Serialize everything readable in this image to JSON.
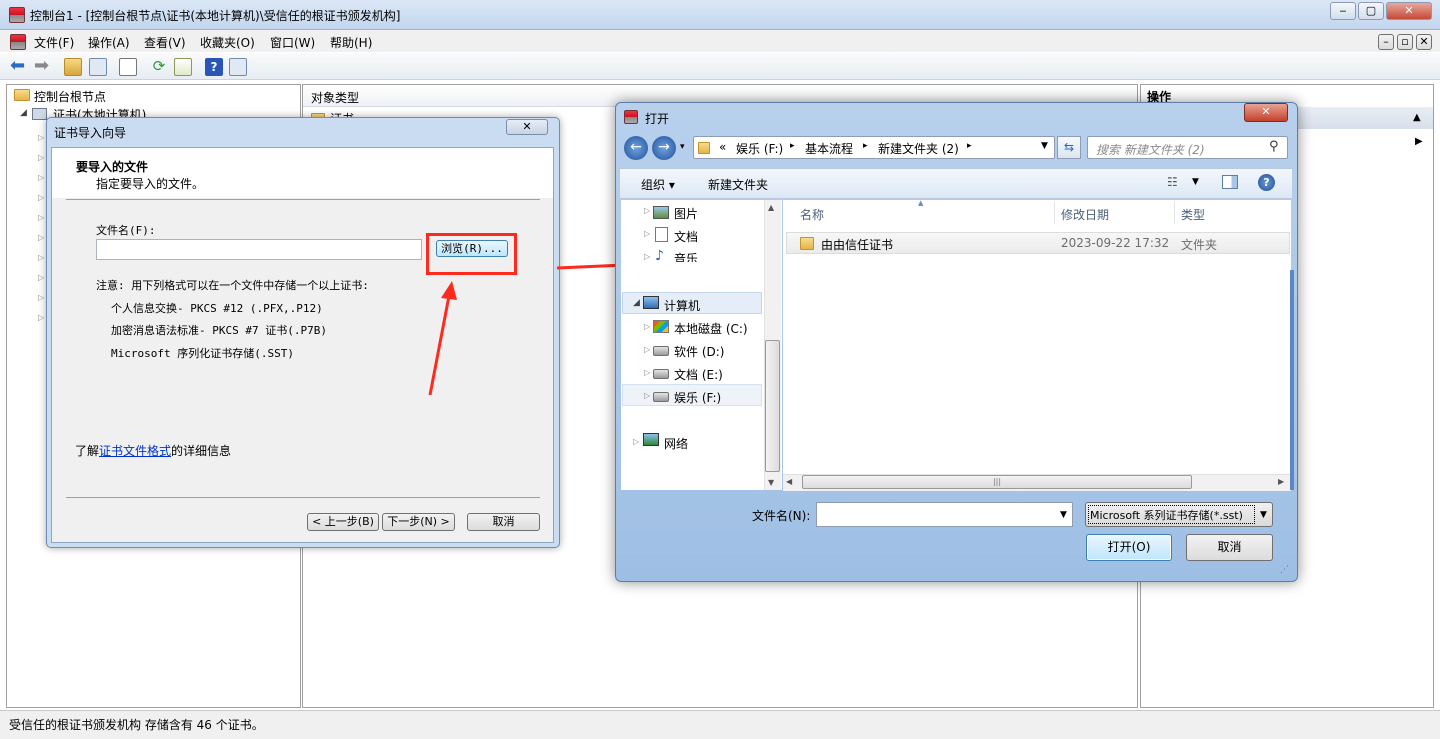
{
  "window": {
    "title": "控制台1 - [控制台根节点\\证书(本地计算机)\\受信任的根证书颁发机构]",
    "min": "‒",
    "max": "▢",
    "close": "✕"
  },
  "menubar": {
    "items": [
      "文件(F)",
      "操作(A)",
      "查看(V)",
      "收藏夹(O)",
      "窗口(W)",
      "帮助(H)"
    ],
    "right_buttons": [
      "–",
      "▫",
      "✕"
    ]
  },
  "tree": {
    "root": "控制台根节点",
    "child": "证书(本地计算机)"
  },
  "middle": {
    "header": "对象类型",
    "row": "证书"
  },
  "actions": {
    "header": "操作"
  },
  "status": "受信任的根证书颁发机构 存储含有 46 个证书。",
  "wizard": {
    "title": "证书导入向导",
    "heading": "要导入的文件",
    "subheading": "指定要导入的文件。",
    "file_label": "文件名(F):",
    "file_value": "",
    "browse": "浏览(R)...",
    "note": "注意: 用下列格式可以在一个文件中存储一个以上证书:",
    "formats": [
      "个人信息交换- PKCS #12 (.PFX,.P12)",
      "加密消息语法标准- PKCS #7 证书(.P7B)",
      "Microsoft 序列化证书存储(.SST)"
    ],
    "learn_prefix": "了解",
    "learn_link": "证书文件格式",
    "learn_suffix": "的详细信息",
    "back": "< 上一步(B)",
    "next": "下一步(N) >",
    "cancel": "取消"
  },
  "open_dialog": {
    "title": "打开",
    "breadcrumb": [
      "«",
      "娱乐 (F:)",
      "基本流程",
      "新建文件夹 (2)"
    ],
    "search_placeholder": "搜索 新建文件夹 (2)",
    "organize": "组织 ▾",
    "new_folder": "新建文件夹",
    "nav": {
      "pictures": "图片",
      "documents": "文档",
      "music": "音乐",
      "computer": "计算机",
      "drives": [
        "本地磁盘 (C:)",
        "软件 (D:)",
        "文档 (E:)",
        "娱乐 (F:)"
      ],
      "network": "网络"
    },
    "columns": [
      "名称",
      "修改日期",
      "类型"
    ],
    "files": [
      {
        "name": "由由信任证书",
        "date": "2023-09-22 17:32",
        "type": "文件夹"
      }
    ],
    "filename_label": "文件名(N):",
    "filename_value": "",
    "filter": "Microsoft 系列证书存储(*.sst)",
    "open": "打开(O)",
    "cancel": "取消"
  },
  "colors": {
    "accent": "#ff2a1e",
    "link": "#0033cc",
    "selection": "#cce8ff"
  }
}
